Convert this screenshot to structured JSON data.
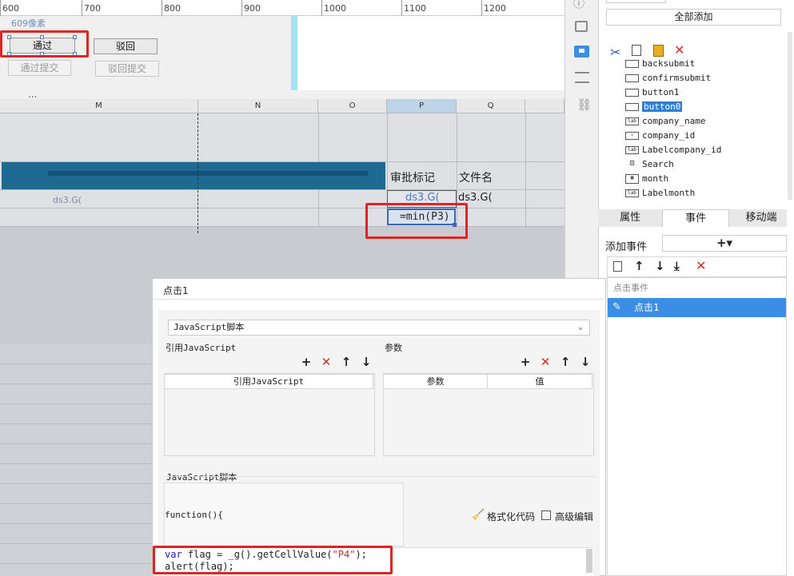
{
  "ruler": {
    "labels": [
      "600",
      "700",
      "800",
      "900",
      "1000",
      "1100",
      "1200"
    ],
    "unit_label": "609像素"
  },
  "design_buttons": {
    "pass": "通过",
    "reject": "驳回",
    "pass_submit": "通过提交",
    "reject_submit": "驳回提交"
  },
  "ellipsis": "...",
  "columns": [
    "M",
    "N",
    "O",
    "P",
    "Q"
  ],
  "cells": {
    "approval_mark": "审批标记",
    "file_name": "文件名",
    "ds3_p": "ds3.G(",
    "ds3_q": "ds3.G(",
    "formula": "=min(P3)",
    "ds_left": "ds3.G("
  },
  "right_panel": {
    "add_all": "全部添加",
    "widgets": [
      {
        "name": "backsubmit",
        "icon": "button"
      },
      {
        "name": "confirmsubmit",
        "icon": "button"
      },
      {
        "name": "button1",
        "icon": "button"
      },
      {
        "name": "button0",
        "icon": "button",
        "selected": true
      },
      {
        "name": "company_name",
        "icon": "label"
      },
      {
        "name": "company_id",
        "icon": "combobox"
      },
      {
        "name": "Labelcompany_id",
        "icon": "label"
      },
      {
        "name": "Search",
        "icon": "search"
      },
      {
        "name": "month",
        "icon": "calendar"
      },
      {
        "name": "Labelmonth",
        "icon": "label"
      }
    ],
    "tabs": [
      "属性",
      "事件",
      "移动端"
    ],
    "add_event_label": "添加事件",
    "add_event_button": "+▾",
    "event_group": "点击事件",
    "event_item": "点击1"
  },
  "dialog": {
    "title": "点击1",
    "type_select": "JavaScript脚本",
    "ref_js_label": "引用JavaScript",
    "params_label": "参数",
    "ref_js_col": "引用JavaScript",
    "param_col": "参数",
    "value_col": "值",
    "script_label": "JavaScript脚本",
    "function_sig": "function(){",
    "format_code": "格式化代码",
    "advanced_edit": "高级编辑",
    "code_line1_kw": "var",
    "code_line1_rest": " flag = _g().getCellValue(",
    "code_line1_str": "\"P4\"",
    "code_line1_end": ");",
    "code_line2": "alert(flag);"
  },
  "colors": {
    "accent": "#3a8ee6",
    "highlight_red": "#e02424",
    "banner": "#1f6a93",
    "selection_blue": "#3b66b5"
  }
}
